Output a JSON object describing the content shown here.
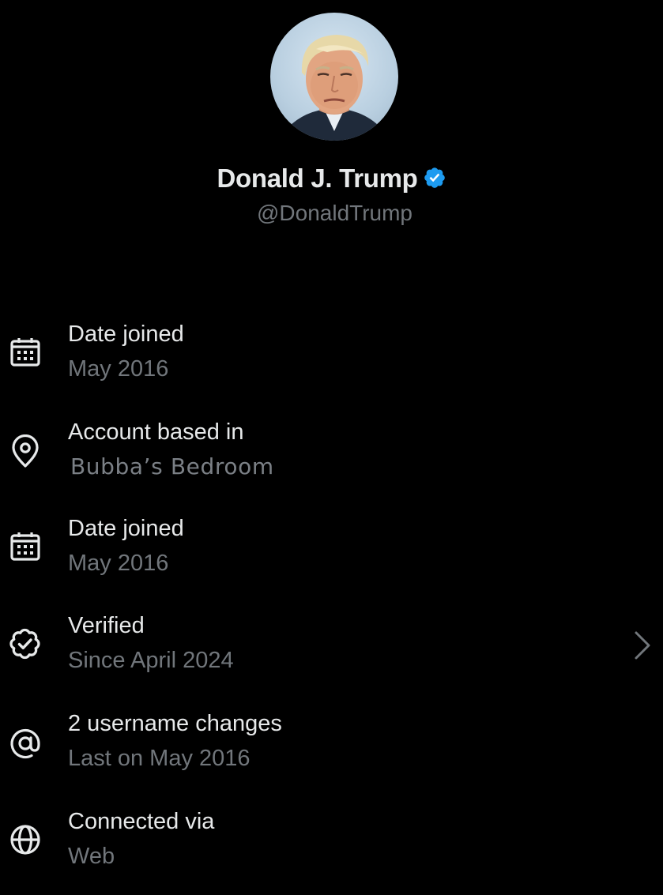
{
  "profile": {
    "display_name": "Donald J. Trump",
    "handle": "@DonaldTrump",
    "verified": true,
    "badge_color": "#1d9bf0"
  },
  "about_rows": [
    {
      "icon": "calendar-icon",
      "title": "Date joined",
      "value": "May 2016"
    },
    {
      "icon": "location-pin-icon",
      "title": "Account based in",
      "value": "Bubba’s Bedroom"
    },
    {
      "icon": "calendar-icon",
      "title": "Date joined",
      "value": "May 2016"
    },
    {
      "icon": "verified-check-icon",
      "title": "Verified",
      "value": "Since April 2024",
      "has_chevron": true
    },
    {
      "icon": "at-sign-icon",
      "title": "2 username changes",
      "value": "Last on May 2016"
    },
    {
      "icon": "globe-icon",
      "title": "Connected via",
      "value": "Web"
    }
  ],
  "colors": {
    "background": "#000000",
    "primary_text": "#e7e9ea",
    "secondary_text": "#71767b",
    "accent": "#1d9bf0"
  }
}
